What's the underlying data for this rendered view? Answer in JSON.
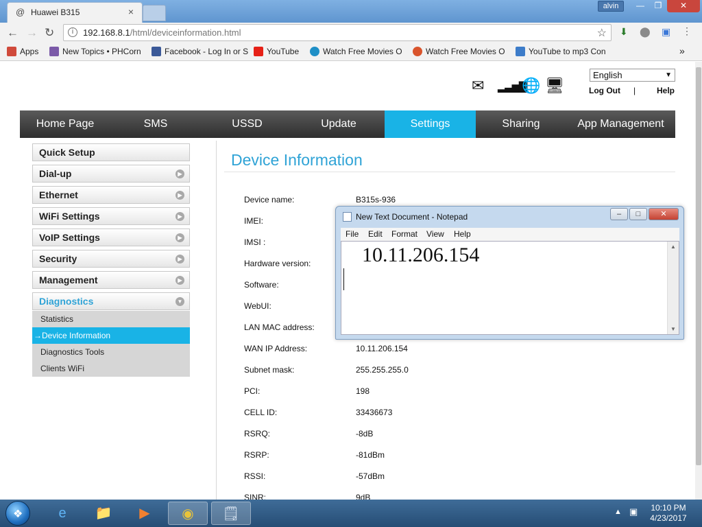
{
  "browser": {
    "tab_title": "Huawei B315",
    "tab_close": "×",
    "user": "alvin",
    "url_host": "192.168.8.1",
    "url_path": "/html/deviceinformation.html",
    "bookmarks": [
      {
        "label": "Apps",
        "color": "#d04a3b"
      },
      {
        "label": "New Topics • PHCorn",
        "color": "#7b5aa8"
      },
      {
        "label": "Facebook - Log In or S",
        "color": "#3b5998"
      },
      {
        "label": "YouTube",
        "color": "#e62117"
      },
      {
        "label": "Watch Free Movies O",
        "color": "#1e8fc6"
      },
      {
        "label": "Watch Free Movies O",
        "color": "#d9542c"
      },
      {
        "label": "YouTube to mp3 Con",
        "color": "#3d7cc9"
      }
    ],
    "more": "»"
  },
  "header": {
    "language": "English",
    "logout": "Log Out",
    "separator": "|",
    "help": "Help"
  },
  "menu": [
    "Home Page",
    "SMS",
    "USSD",
    "Update",
    "Settings",
    "Sharing",
    "App Management"
  ],
  "menu_active": "Settings",
  "sidebar": {
    "items": [
      "Quick Setup",
      "Dial-up",
      "Ethernet",
      "WiFi Settings",
      "VoIP Settings",
      "Security",
      "Management",
      "Diagnostics"
    ],
    "sub_items": [
      "Statistics",
      "Device Information",
      "Diagnostics Tools",
      "Clients WiFi"
    ],
    "active_sub": "Device Information",
    "active_arrow": "→"
  },
  "content": {
    "title": "Device Information",
    "rows": [
      {
        "label": "Device name:",
        "value": "B315s-936"
      },
      {
        "label": "IMEI:",
        "value": ""
      },
      {
        "label": "IMSI :",
        "value": ""
      },
      {
        "label": "Hardware version:",
        "value": ""
      },
      {
        "label": "Software:",
        "value": ""
      },
      {
        "label": "WebUI:",
        "value": ""
      },
      {
        "label": "LAN MAC address:",
        "value": ""
      },
      {
        "label": "WAN IP Address:",
        "value": "10.11.206.154"
      },
      {
        "label": "Subnet mask:",
        "value": "255.255.255.0"
      },
      {
        "label": "PCI:",
        "value": "198"
      },
      {
        "label": "CELL ID:",
        "value": "33436673"
      },
      {
        "label": "RSRQ:",
        "value": "-8dB"
      },
      {
        "label": "RSRP:",
        "value": "-81dBm"
      },
      {
        "label": "RSSI:",
        "value": "-57dBm"
      },
      {
        "label": "SINR:",
        "value": "9dB"
      }
    ]
  },
  "notepad": {
    "title": "New Text Document - Notepad",
    "menu": [
      "File",
      "Edit",
      "Format",
      "View",
      "Help"
    ],
    "text": "10.11.206.154"
  },
  "taskbar": {
    "time": "10:10 PM",
    "date": "4/23/2017"
  },
  "colors": {
    "accent": "#19b3e6",
    "title_blue": "#2fa3d6"
  }
}
